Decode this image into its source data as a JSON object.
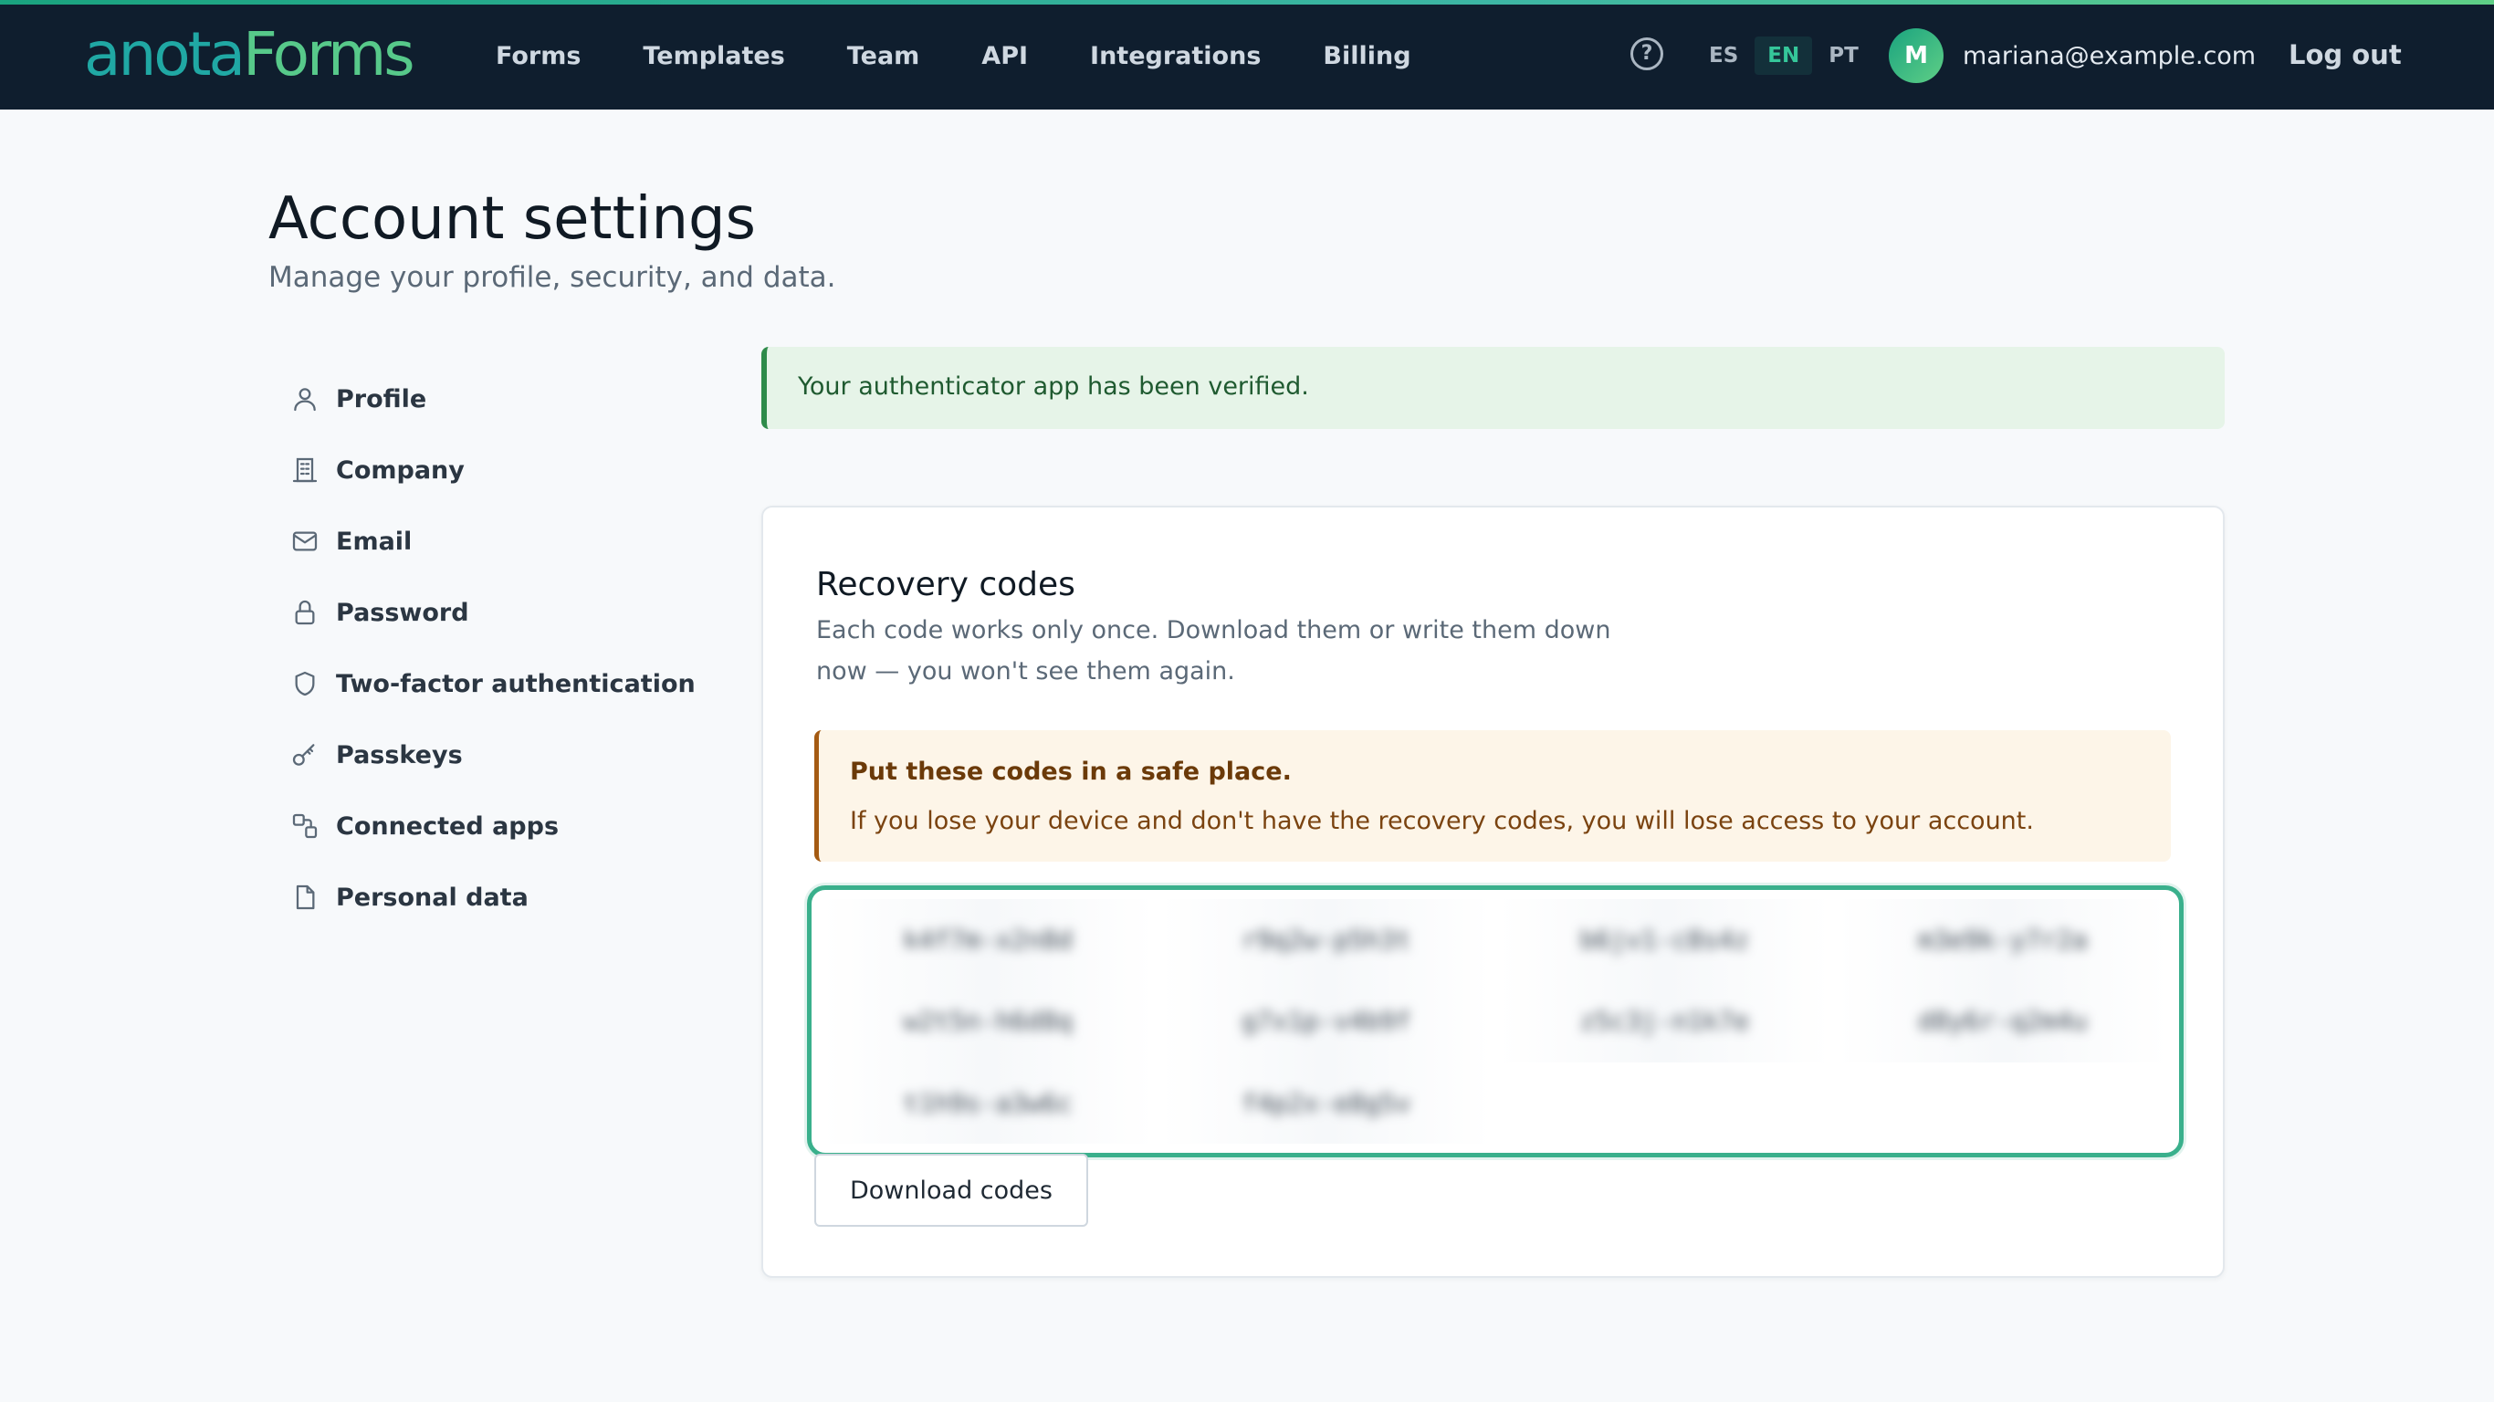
{
  "brand": {
    "logo_part1": "anota",
    "logo_part2": "Forms"
  },
  "nav": {
    "items": [
      {
        "label": "Forms"
      },
      {
        "label": "Templates"
      },
      {
        "label": "Team"
      },
      {
        "label": "API"
      },
      {
        "label": "Integrations"
      },
      {
        "label": "Billing"
      }
    ],
    "help_glyph": "?",
    "languages": [
      {
        "label": "ES"
      },
      {
        "label": "EN"
      },
      {
        "label": "PT"
      }
    ],
    "active_language": "EN",
    "user": {
      "initial": "M",
      "email": "mariana@example.com"
    },
    "logout_label": "Log out"
  },
  "page": {
    "title": "Account settings",
    "subtitle": "Manage your profile, security, and data."
  },
  "sidebar": {
    "items": [
      {
        "label": "Profile",
        "icon": "user-icon"
      },
      {
        "label": "Company",
        "icon": "building-icon"
      },
      {
        "label": "Email",
        "icon": "mail-icon"
      },
      {
        "label": "Password",
        "icon": "lock-icon"
      },
      {
        "label": "Two-factor authentication",
        "icon": "shield-icon"
      },
      {
        "label": "Passkeys",
        "icon": "key-icon"
      },
      {
        "label": "Connected apps",
        "icon": "connected-apps-icon"
      },
      {
        "label": "Personal data",
        "icon": "file-icon"
      }
    ]
  },
  "alert": {
    "message": "Your authenticator app has been verified."
  },
  "recovery": {
    "title": "Recovery codes",
    "description": "Each code works only once. Download them or write them down now — you won't see them again.",
    "warning_title": "Put these codes in a safe place.",
    "warning_body": "If you lose your device and don't have the recovery codes, you will lose access to your account.",
    "codes": [
      "k4f7m-x2n8d",
      "r9q2w-p5h3t",
      "b6jv1-c8s4z",
      "m3e9k-y7r2a",
      "w2t5n-h6d8q",
      "g7x1p-v4b9f",
      "z5c3j-n1k7e",
      "d8y6r-q2m4u",
      "t1h9s-a3w6c",
      "f4p2x-e8g5v"
    ],
    "download_label": "Download codes"
  },
  "colors": {
    "topbar": "#0f1e2e",
    "accent": "#1aa37f",
    "success_bg": "#e6f4e8",
    "warning_bg": "#fdf5e8",
    "codes_border": "#3ab08c"
  }
}
